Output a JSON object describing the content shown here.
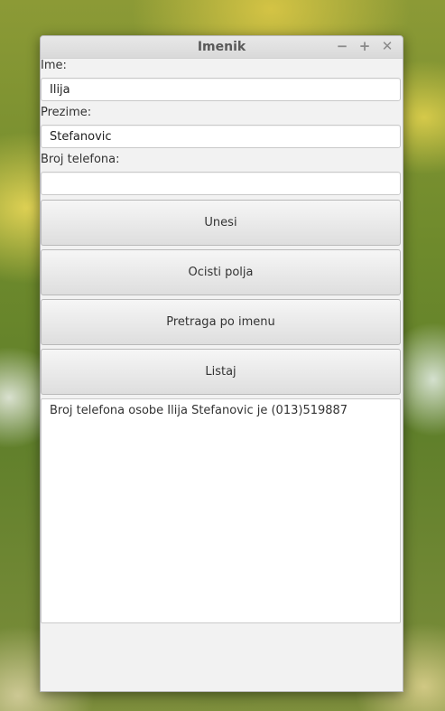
{
  "window": {
    "title": "Imenik",
    "controls": [
      "minimize-icon",
      "maximize-icon",
      "close-icon"
    ],
    "minimize_glyph": "−",
    "maximize_glyph": "+",
    "close_glyph": "✕"
  },
  "form": {
    "first_name_label": "Ime:",
    "first_name_value": "Ilija",
    "last_name_label": "Prezime:",
    "last_name_value": "Stefanovic",
    "phone_label": "Broj telefona:",
    "phone_value": ""
  },
  "buttons": {
    "enter_label": "Unesi",
    "clear_label": "Ocisti polja",
    "search_label": "Pretraga po imenu",
    "list_label": "Listaj"
  },
  "output": {
    "text": "Broj telefona osobe Ilija Stefanovic je (013)519887"
  },
  "colors": {
    "window_bg": "#f2f2f2",
    "titlebar_text": "#5a5a5a",
    "button_top": "#f6f6f6",
    "button_bottom": "#dedede"
  }
}
